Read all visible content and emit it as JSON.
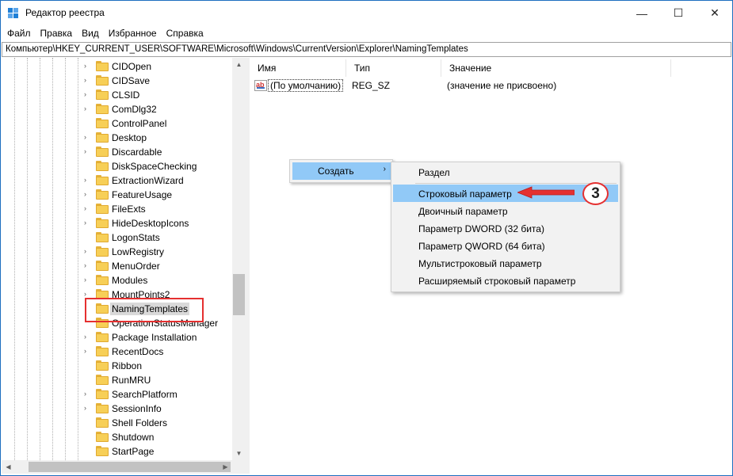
{
  "window": {
    "title": "Редактор реестра",
    "minimize_glyph": "—",
    "maximize_glyph": "☐",
    "close_glyph": "✕"
  },
  "menu": [
    "Файл",
    "Правка",
    "Вид",
    "Избранное",
    "Справка"
  ],
  "address": "Компьютер\\HKEY_CURRENT_USER\\SOFTWARE\\Microsoft\\Windows\\CurrentVersion\\Explorer\\NamingTemplates",
  "tree": {
    "items": [
      {
        "label": "CIDOpen",
        "expandable": true
      },
      {
        "label": "CIDSave",
        "expandable": true
      },
      {
        "label": "CLSID",
        "expandable": true
      },
      {
        "label": "ComDlg32",
        "expandable": true
      },
      {
        "label": "ControlPanel",
        "expandable": false
      },
      {
        "label": "Desktop",
        "expandable": true
      },
      {
        "label": "Discardable",
        "expandable": true
      },
      {
        "label": "DiskSpaceChecking",
        "expandable": false
      },
      {
        "label": "ExtractionWizard",
        "expandable": true
      },
      {
        "label": "FeatureUsage",
        "expandable": true
      },
      {
        "label": "FileExts",
        "expandable": true
      },
      {
        "label": "HideDesktopIcons",
        "expandable": true
      },
      {
        "label": "LogonStats",
        "expandable": false
      },
      {
        "label": "LowRegistry",
        "expandable": true
      },
      {
        "label": "MenuOrder",
        "expandable": true
      },
      {
        "label": "Modules",
        "expandable": true
      },
      {
        "label": "MountPoints2",
        "expandable": true
      },
      {
        "label": "NamingTemplates",
        "expandable": false,
        "selected": true
      },
      {
        "label": "OperationStatusManager",
        "expandable": false
      },
      {
        "label": "Package Installation",
        "expandable": true
      },
      {
        "label": "RecentDocs",
        "expandable": true
      },
      {
        "label": "Ribbon",
        "expandable": false
      },
      {
        "label": "RunMRU",
        "expandable": false
      },
      {
        "label": "SearchPlatform",
        "expandable": true
      },
      {
        "label": "SessionInfo",
        "expandable": true
      },
      {
        "label": "Shell Folders",
        "expandable": false
      },
      {
        "label": "Shutdown",
        "expandable": false
      },
      {
        "label": "StartPage",
        "expandable": false
      }
    ]
  },
  "columns": {
    "name": "Имя",
    "type": "Тип",
    "value": "Значение"
  },
  "values": [
    {
      "name": "(По умолчанию)",
      "type": "REG_SZ",
      "data": "(значение не присвоено)"
    }
  ],
  "context_menu": {
    "create_label": "Создать",
    "submenu_arrow": "›",
    "submenu": [
      "Раздел",
      "Строковый параметр",
      "Двоичный параметр",
      "Параметр DWORD (32 бита)",
      "Параметр QWORD (64 бита)",
      "Мультистроковый параметр",
      "Расширяемый строковый параметр"
    ],
    "highlighted_index": 1
  },
  "annotation": {
    "badge": "3",
    "color": "#e53030"
  },
  "colors": {
    "selection": "#91c9f7",
    "folder": "#f7cf57",
    "accent_border": "#1e6fbf"
  }
}
